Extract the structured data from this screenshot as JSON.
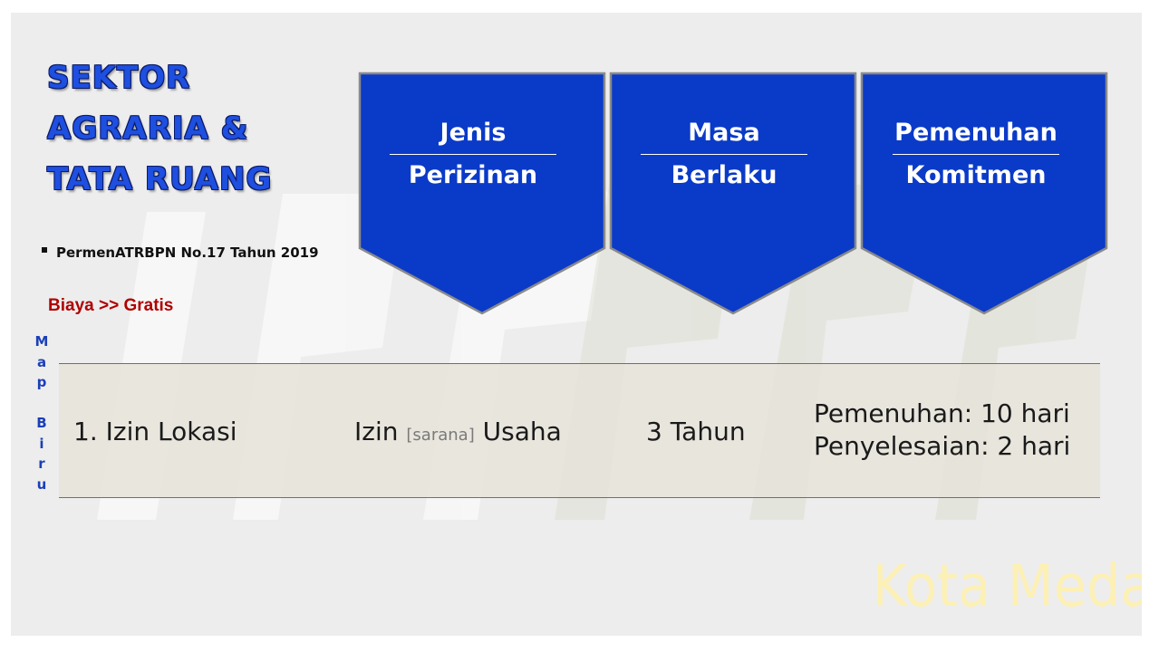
{
  "title": {
    "lines": [
      "SEKTOR",
      "AGRARIA &",
      "TATA RUANG"
    ]
  },
  "regulation": "PermenATRBPN  No.17 Tahun  2019",
  "cost": "Biaya >> Gratis",
  "map_label": [
    "M",
    "a",
    "p",
    "",
    "B",
    "i",
    "r",
    "u"
  ],
  "headers": [
    {
      "line1": "Jenis",
      "line2": "Perizinan"
    },
    {
      "line1": "Masa",
      "line2": "Berlaku"
    },
    {
      "line1": "Pemenuhan",
      "line2": "Komitmen"
    }
  ],
  "row": {
    "permit": "1.  Izin Lokasi",
    "business_prefix": "Izin ",
    "business_small": "[sarana]",
    "business_suffix": " Usaha",
    "validity": "3 Tahun",
    "fulfillment": "Pemenuhan:  10 hari",
    "completion": "Penyelesaian:  2 hari"
  },
  "watermark": {
    "text": "Kota Medan"
  },
  "colors": {
    "title_blue": "#1e4fe0",
    "chevron_blue": "#0a3ac8",
    "cost_red": "#b00000",
    "watermark_yellow": "#fff1b0"
  }
}
